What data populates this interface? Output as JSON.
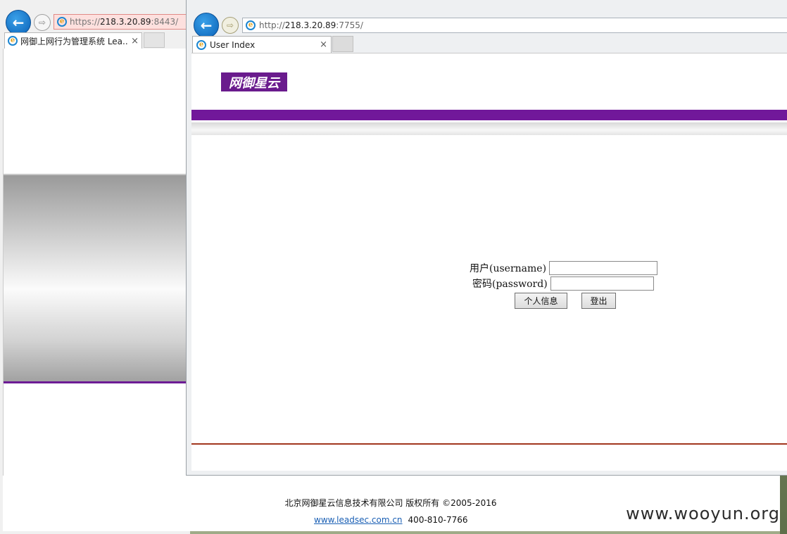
{
  "back_window": {
    "address": {
      "scheme": "https://",
      "host": "218.3.20.89",
      "port_path": ":8443/"
    },
    "tab": {
      "title": "网御上网行为管理系统 Lea...",
      "close": "×"
    }
  },
  "front_window": {
    "address": {
      "scheme": "http://",
      "host": "218.3.20.89",
      "port_path": ":7755/"
    },
    "tab": {
      "title": "User Index",
      "close": "×"
    }
  },
  "page": {
    "logo_text": "网御星云",
    "login": {
      "username_label": "用户(username)",
      "password_label": "密码(password)",
      "username_value": "",
      "password_value": "",
      "info_button": "个人信息",
      "logout_button": "登出"
    }
  },
  "footer": {
    "copyright": "北京网御星云信息技术有限公司 版权所有 ©2005-2016",
    "link": "www.leadsec.com.cn",
    "phone": "400-810-7766"
  },
  "watermark": "www.wooyun.org",
  "icons": {
    "back": "back-arrow-icon",
    "forward": "forward-arrow-icon",
    "browser": "ie-icon"
  },
  "colors": {
    "brand_purple": "#71189a",
    "footer_line": "#a1361e",
    "link": "#1a5fb4"
  }
}
